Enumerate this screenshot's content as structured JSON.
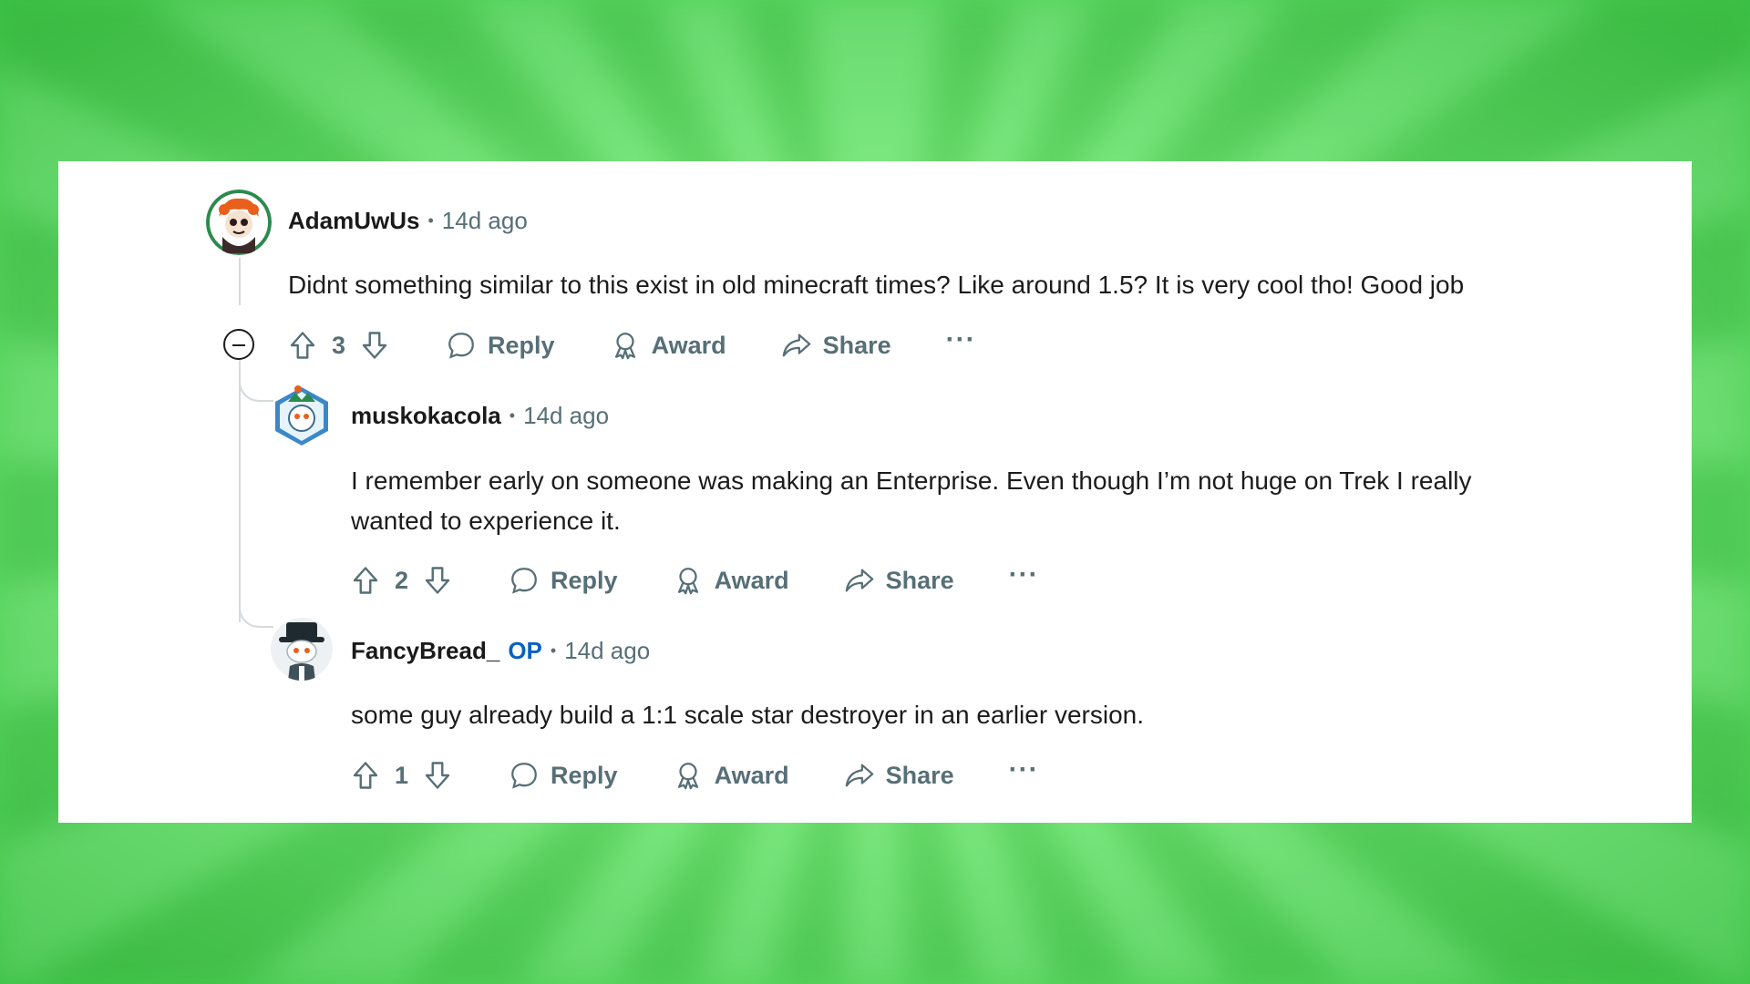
{
  "comments": [
    {
      "username": "AdamUwUs",
      "op_badge": "",
      "separator": "•",
      "time": "14d ago",
      "body": "Didnt something similar to this exist in old minecraft times? Like around 1.5? It is very cool tho! Good job",
      "votes": "3",
      "reply_label": "Reply",
      "award_label": "Award",
      "share_label": "Share",
      "more_label": "···"
    },
    {
      "username": "muskokacola",
      "op_badge": "",
      "separator": "•",
      "time": "14d ago",
      "body_line1": "I remember early on someone was making an Enterprise. Even though I’m not huge on Trek I really",
      "body_line2": "wanted to experience it.",
      "votes": "2",
      "reply_label": "Reply",
      "award_label": "Award",
      "share_label": "Share",
      "more_label": "···"
    },
    {
      "username": "FancyBread_",
      "op_badge": "OP",
      "separator": "•",
      "time": "14d ago",
      "body": "some guy already build a 1:1 scale star destroyer in an earlier version.",
      "votes": "1",
      "reply_label": "Reply",
      "award_label": "Award",
      "share_label": "Share",
      "more_label": "···"
    }
  ],
  "colors": {
    "background_green": "#6ee672",
    "op_blue": "#0a5fc2",
    "meta_gray": "#576f76",
    "text": "#1c1c1c"
  },
  "icons": [
    "upvote-icon",
    "downvote-icon",
    "reply-icon",
    "award-icon",
    "share-icon",
    "more-icon",
    "collapse-icon"
  ]
}
